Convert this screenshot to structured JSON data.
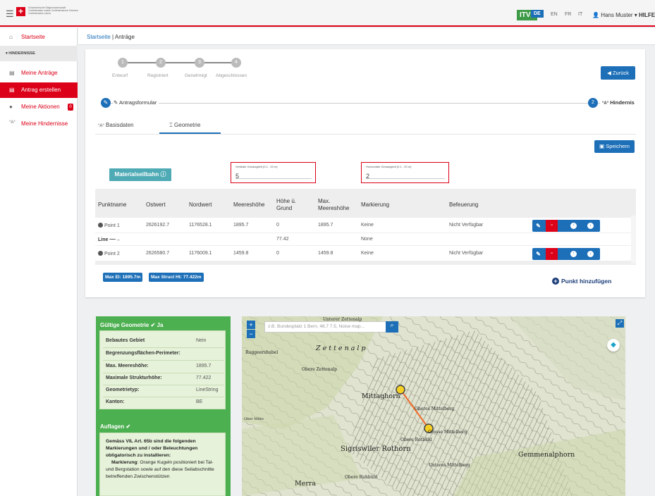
{
  "header": {
    "confederation": "Schweizerische Eidgenossenschaft Confédération suisse Confederazione Svizzera Confederaziun svizra",
    "app_badge": "ITV2",
    "languages": [
      "DE",
      "EN",
      "FR",
      "IT"
    ],
    "active_language": "DE",
    "user": "Hans Muster",
    "help": "HILFE"
  },
  "sidebar": {
    "home": "Startseite",
    "section": "▾ HINDERNISSE",
    "items": [
      "Meine Anträge",
      "Antrag erstellen",
      "Meine Aktionen",
      "Meine Hindernisse"
    ],
    "actions_badge": "0"
  },
  "breadcrumb": {
    "home": "Startseite",
    "sep": "|",
    "current": "Anträge"
  },
  "steps": [
    {
      "num": "1",
      "label": "Entwurf"
    },
    {
      "num": "2",
      "label": "Registriert"
    },
    {
      "num": "3",
      "label": "Genehmigt"
    },
    {
      "num": "4",
      "label": "Abgeschlossen"
    }
  ],
  "back_button": "Zurück",
  "form_steps": {
    "first_label": "Antragsformular",
    "second_num": "2",
    "second_label": "Hindernis"
  },
  "tabs": [
    "Basisdaten",
    "Geometrie"
  ],
  "save_button": "Speichern",
  "material_button": "Materialseilbahn",
  "vertical_accuracy": {
    "label": "Vertikale Genauigkeit (0.1 - 20 m)",
    "value": "5"
  },
  "horizontal_accuracy": {
    "label": "Horizontale Genauigkeit (0.1 - 20 m)",
    "value": "2"
  },
  "table": {
    "headers": [
      "Punktname",
      "Ostwert",
      "Nordwert",
      "Meereshöhe",
      "Höhe ü. Grund",
      "Max. Meereshöhe",
      "Markierung",
      "Befeuerung"
    ],
    "rows": [
      {
        "name": "Point 1",
        "ost": "2626192.7",
        "nord": "1176528.1",
        "hoehe": "1895.7",
        "grund": "0",
        "max": "1895.7",
        "mark": "Keine",
        "feuer": "Nicht Verfügbar"
      },
      {
        "name": "Point 2",
        "ost": "2626580.7",
        "nord": "1176009.1",
        "hoehe": "1459.8",
        "grund": "0",
        "max": "1459.8",
        "mark": "Keine",
        "feuer": "Nicht Verfügbar"
      }
    ],
    "line": {
      "name": "Line",
      "grund": "77.42",
      "mark": "None"
    }
  },
  "summary": {
    "max_el": "Max El: 1895.7m",
    "max_struct": "Max Struct Ht: 77.422m"
  },
  "add_point": "Punkt hinzufügen",
  "geometry": {
    "title": "Gültige Geometrie",
    "status": "Ja",
    "rows": [
      {
        "label": "Bebautes Gebiet",
        "value": "Nein"
      },
      {
        "label": "Begrenzungsflächen-Perimeter:",
        "value": ""
      },
      {
        "label": "Max. Meereshöhe:",
        "value": "1895.7"
      },
      {
        "label": "Maximale Strukturhöhe:",
        "value": "77.422"
      },
      {
        "label": "Geometrietyp:",
        "value": "LineString"
      },
      {
        "label": "Kanton:",
        "value": "BE"
      }
    ],
    "auflagen_title": "Auflagen",
    "note_intro": "Gemäss VIL Art. 65b sind die folgenden Markierungen und / oder Beleuchtungen obligatorisch zu installieren:",
    "note_label": "Markierung",
    "note_text": ": Orange Kugeln positioniert bei Tal- und Bergstation sowie auf den diese Seilabschnitte betreffenden Zwischenstützen"
  },
  "map": {
    "search_placeholder": "z.B. Bundesplatz 1 Bern, 46.7 7.5, Noise map...",
    "labels": [
      "Unterer Zettenalp",
      "Ruggeershubel",
      "Z e t t e n a l p",
      "Obere Zettenalp",
      "Mittaghorn",
      "Oberes Mittelberg",
      "Grosse Mittelberg",
      "Obere Rotbühl",
      "Sigriswiler Rothorn",
      "Unteres Mittelberg",
      "Gemmenalphorn",
      "Merra",
      "Ober Mitte",
      "Obere Ruhbühl"
    ]
  }
}
